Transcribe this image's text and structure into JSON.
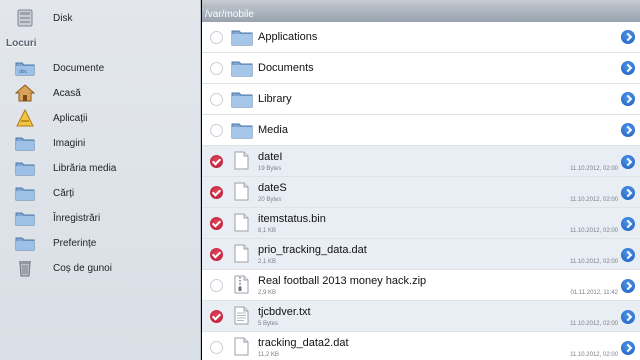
{
  "sidebar": {
    "disk": {
      "label": "Disk",
      "icon": "disk-icon"
    },
    "section_header": "Locuri",
    "items": [
      {
        "label": "Documente",
        "icon": "folder-icon"
      },
      {
        "label": "Acasă",
        "icon": "home-icon"
      },
      {
        "label": "Aplicații",
        "icon": "applications-icon"
      },
      {
        "label": "Imagini",
        "icon": "folder-icon"
      },
      {
        "label": "Librăria media",
        "icon": "folder-icon"
      },
      {
        "label": "Cărți",
        "icon": "folder-icon"
      },
      {
        "label": "Înregistrări",
        "icon": "folder-icon"
      },
      {
        "label": "Preferințe",
        "icon": "folder-icon"
      },
      {
        "label": "Coș de gunoi",
        "icon": "trash-icon"
      }
    ]
  },
  "main": {
    "path": "/var/mobile",
    "rows": [
      {
        "name": "Applications",
        "type": "folder",
        "selected": false
      },
      {
        "name": "Documents",
        "type": "folder",
        "selected": false
      },
      {
        "name": "Library",
        "type": "folder",
        "selected": false
      },
      {
        "name": "Media",
        "type": "folder",
        "selected": false
      },
      {
        "name": "dateI",
        "type": "file",
        "size": "19 Bytes",
        "date": "11.10.2012, 02:00",
        "selected": true
      },
      {
        "name": "dateS",
        "type": "file",
        "size": "20 Bytes",
        "date": "11.10.2012, 02:00",
        "selected": true
      },
      {
        "name": "itemstatus.bin",
        "type": "file",
        "size": "8,1 KB",
        "date": "11.10.2012, 02:00",
        "selected": true
      },
      {
        "name": "prio_tracking_data.dat",
        "type": "file",
        "size": "2,1 KB",
        "date": "11.10.2012, 02:00",
        "selected": true
      },
      {
        "name": "Real football 2013 money hack.zip",
        "type": "zip",
        "size": "2,9 KB",
        "date": "01.11.2012, 11:42",
        "selected": false
      },
      {
        "name": "tjcbdver.txt",
        "type": "text",
        "size": "5 Bytes",
        "date": "11.10.2012, 02:00",
        "selected": true
      },
      {
        "name": "tracking_data2.dat",
        "type": "file",
        "size": "11,2 KB",
        "date": "11.10.2012, 02:00",
        "selected": false
      }
    ]
  }
}
